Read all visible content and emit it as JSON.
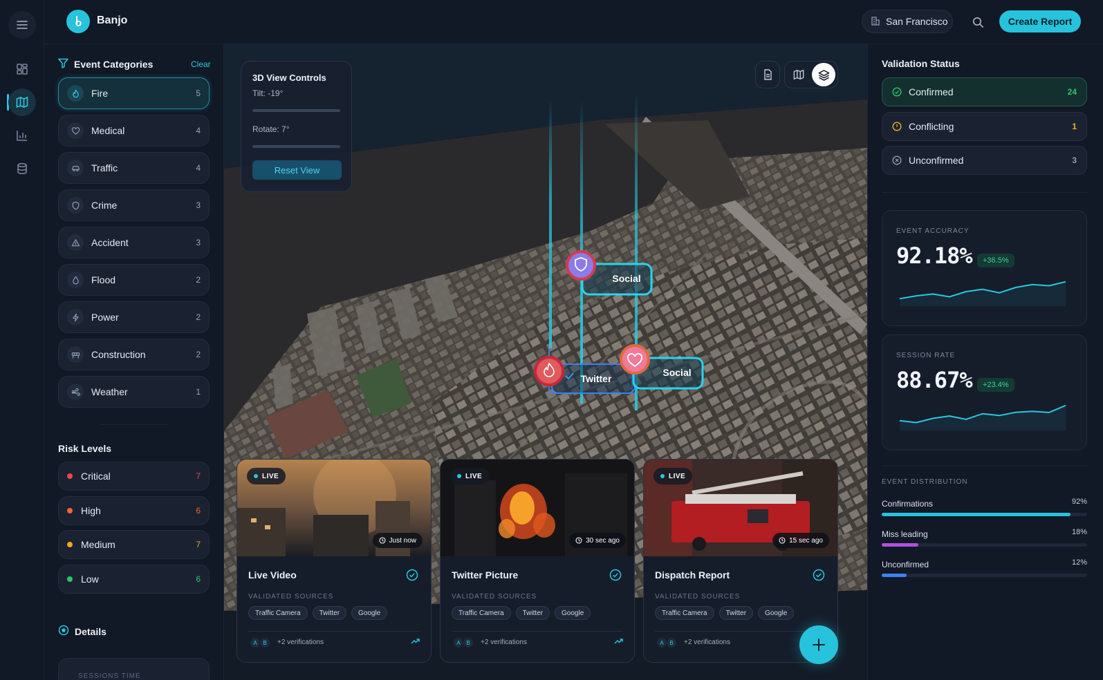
{
  "app": {
    "name": "Banjo"
  },
  "header": {
    "city": "San Francisco",
    "create_label": "Create Report"
  },
  "rail": {
    "items": [
      "menu-icon",
      "dashboard-icon",
      "map-icon",
      "chart-icon",
      "database-icon"
    ],
    "active": "map-icon"
  },
  "categories": {
    "title": "Event Categories",
    "clear_label": "Clear",
    "items": [
      {
        "label": "Fire",
        "count": "5",
        "icon": "flame-icon"
      },
      {
        "label": "Medical",
        "count": "4",
        "icon": "heart-icon"
      },
      {
        "label": "Traffic",
        "count": "4",
        "icon": "car-icon"
      },
      {
        "label": "Crime",
        "count": "3",
        "icon": "shield-icon"
      },
      {
        "label": "Accident",
        "count": "3",
        "icon": "warning-icon"
      },
      {
        "label": "Flood",
        "count": "2",
        "icon": "droplet-icon"
      },
      {
        "label": "Power",
        "count": "2",
        "icon": "bolt-icon"
      },
      {
        "label": "Construction",
        "count": "2",
        "icon": "barrier-icon"
      },
      {
        "label": "Weather",
        "count": "1",
        "icon": "wind-icon"
      }
    ]
  },
  "risk": {
    "title": "Risk Levels",
    "items": [
      {
        "label": "Critical",
        "count": "7",
        "color": "#e5484d"
      },
      {
        "label": "High",
        "count": "6",
        "color": "#f0652f"
      },
      {
        "label": "Medium",
        "count": "7",
        "color": "#f0a81c"
      },
      {
        "label": "Low",
        "count": "6",
        "color": "#2fc46b"
      }
    ]
  },
  "details": {
    "title": "Details",
    "card_label": "SESSIONS TIME"
  },
  "map_controls": {
    "title": "3D View Controls",
    "tilt": "Tilt: -19°",
    "rotate": "Rotate: 7°",
    "reset_label": "Reset View"
  },
  "map_markers": {
    "social_1": "Social",
    "twitter": "Twitter",
    "social_2": "Social"
  },
  "feeds": [
    {
      "live": "LIVE",
      "time": "Just now",
      "title": "Live Video",
      "sources_label": "VALIDATED SOURCES",
      "chips": [
        "Traffic Camera",
        "Twitter",
        "Google"
      ],
      "avatars": [
        "A",
        "B"
      ],
      "verifications": "+2 verifications"
    },
    {
      "live": "LIVE",
      "time": "30 sec ago",
      "title": "Twitter Picture",
      "sources_label": "VALIDATED SOURCES",
      "chips": [
        "Traffic Camera",
        "Twitter",
        "Google"
      ],
      "avatars": [
        "A",
        "B"
      ],
      "verifications": "+2 verifications"
    },
    {
      "live": "LIVE",
      "time": "15 sec ago",
      "title": "Dispatch Report",
      "sources_label": "VALIDATED SOURCES",
      "chips": [
        "Traffic Camera",
        "Twitter",
        "Google"
      ],
      "avatars": [
        "A",
        "B"
      ],
      "verifications": "+2 verifications"
    }
  ],
  "validation": {
    "title": "Validation Status",
    "items": [
      {
        "label": "Confirmed",
        "count": "24",
        "color": "#2fc46b"
      },
      {
        "label": "Conflicting",
        "count": "1",
        "color": "#f0b21c"
      },
      {
        "label": "Unconfirmed",
        "count": "3",
        "color": "#8e9aae"
      }
    ]
  },
  "stats": [
    {
      "label": "EVENT ACCURACY",
      "value": "92.18%",
      "delta": "+36.5%",
      "trend": [
        0.2,
        0.32,
        0.4,
        0.28,
        0.5,
        0.6,
        0.45,
        0.68,
        0.8,
        0.75,
        0.92
      ]
    },
    {
      "label": "SESSION RATE",
      "value": "88.67%",
      "delta": "+23.4%",
      "trend": [
        0.3,
        0.22,
        0.4,
        0.5,
        0.36,
        0.6,
        0.52,
        0.66,
        0.7,
        0.65,
        0.95
      ]
    }
  ],
  "distribution": {
    "title": "EVENT DISTRIBUTION",
    "items": [
      {
        "label": "Confirmations",
        "pct": "92%",
        "value": 0.92,
        "color": "#27c3dc"
      },
      {
        "label": "Miss leading",
        "pct": "18%",
        "value": 0.18,
        "color": "#b04fe0"
      },
      {
        "label": "Unconfirmed",
        "pct": "12%",
        "value": 0.12,
        "color": "#3b82f6"
      }
    ]
  }
}
